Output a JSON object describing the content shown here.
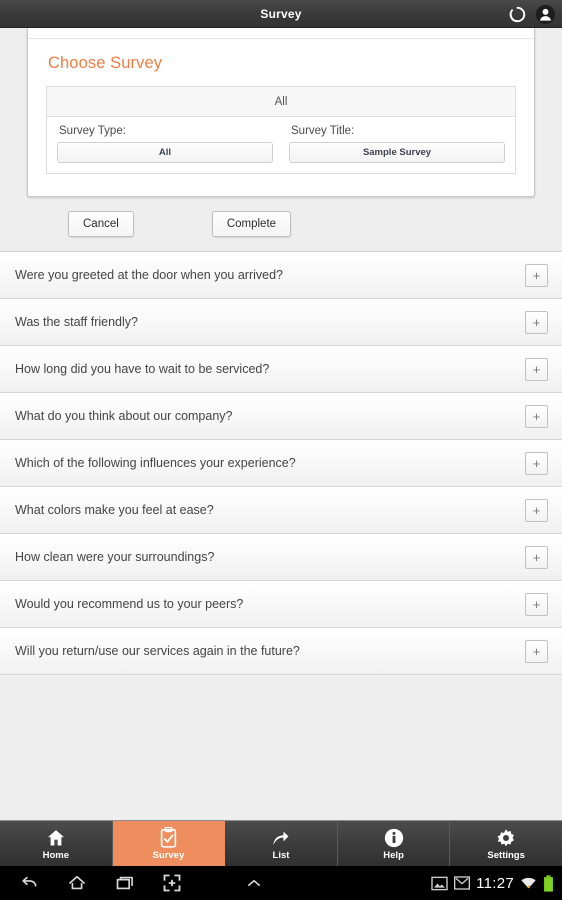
{
  "titlebar": {
    "title": "Survey",
    "refresh_icon": "refresh-icon",
    "account_icon": "account-avatar-icon"
  },
  "card": {
    "heading": "Choose Survey",
    "filter_summary": "All",
    "survey_type": {
      "label": "Survey Type:",
      "value": "All"
    },
    "survey_title": {
      "label": "Survey Title:",
      "value": "Sample Survey"
    }
  },
  "actions": {
    "cancel_label": "Cancel",
    "complete_label": "Complete"
  },
  "questions": [
    {
      "text": "Were you greeted at the door when you arrived?",
      "expand": "+"
    },
    {
      "text": "Was the staff friendly?",
      "expand": "+"
    },
    {
      "text": "How long did you have to wait to be serviced?",
      "expand": "+"
    },
    {
      "text": "What do you think about our company?",
      "expand": "+"
    },
    {
      "text": "Which of the following influences your experience?",
      "expand": "+"
    },
    {
      "text": "What colors make you feel at ease?",
      "expand": "+"
    },
    {
      "text": "How clean were your surroundings?",
      "expand": "+"
    },
    {
      "text": "Would you recommend us to your peers?",
      "expand": "+"
    },
    {
      "text": "Will you return/use our services again in the future?",
      "expand": "+"
    }
  ],
  "tabbar": {
    "active_index": 1,
    "items": [
      {
        "label": "Home",
        "icon": "home-icon"
      },
      {
        "label": "Survey",
        "icon": "clipboard-check-icon"
      },
      {
        "label": "List",
        "icon": "share-arrow-icon"
      },
      {
        "label": "Help",
        "icon": "info-icon"
      },
      {
        "label": "Settings",
        "icon": "gear-icon"
      }
    ]
  },
  "navbar": {
    "buttons": [
      {
        "icon": "back-icon"
      },
      {
        "icon": "home-icon"
      },
      {
        "icon": "recents-icon"
      },
      {
        "icon": "screenshot-icon"
      },
      {
        "icon": "chevron-up-icon"
      }
    ],
    "status": {
      "image_icon": "image-icon",
      "mail_icon": "mail-icon",
      "time": "11:27",
      "wifi_icon": "wifi-icon",
      "battery_icon": "battery-full-icon"
    }
  },
  "colors": {
    "accent_orange": "#ee8e5e",
    "heading_orange": "#ef7c42",
    "titlebar_dark": "#3a3a3a",
    "page_bg": "#eeeeee",
    "battery_green": "#7ed321"
  }
}
